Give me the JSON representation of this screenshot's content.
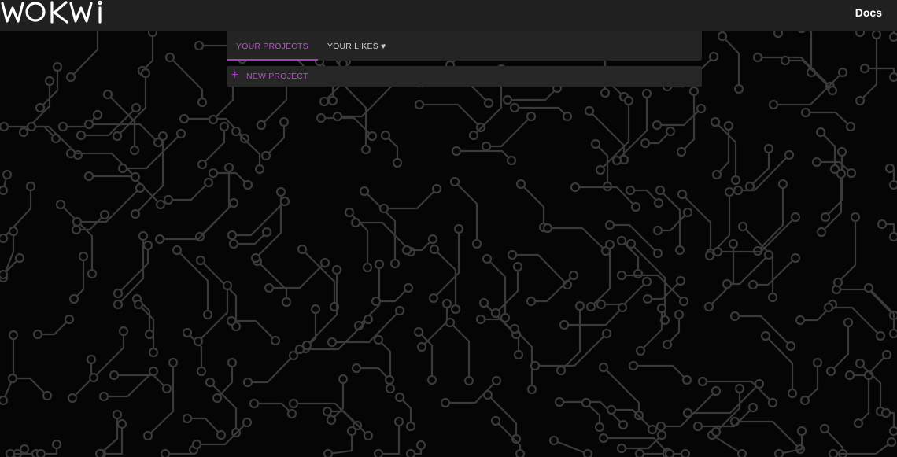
{
  "header": {
    "logo_text": "WOKWI",
    "docs_label": "Docs"
  },
  "tabs": [
    {
      "label": "YOUR PROJECTS",
      "active": true
    },
    {
      "label": "YOUR LIKES ♥",
      "active": false
    }
  ],
  "new_project": {
    "icon": "plus-icon",
    "label": "NEW PROJECT"
  },
  "colors": {
    "header_bg": "#202020",
    "page_bg": "#050505",
    "accent": "#a53cc0",
    "circuit_trace": "#3a3a3a"
  }
}
